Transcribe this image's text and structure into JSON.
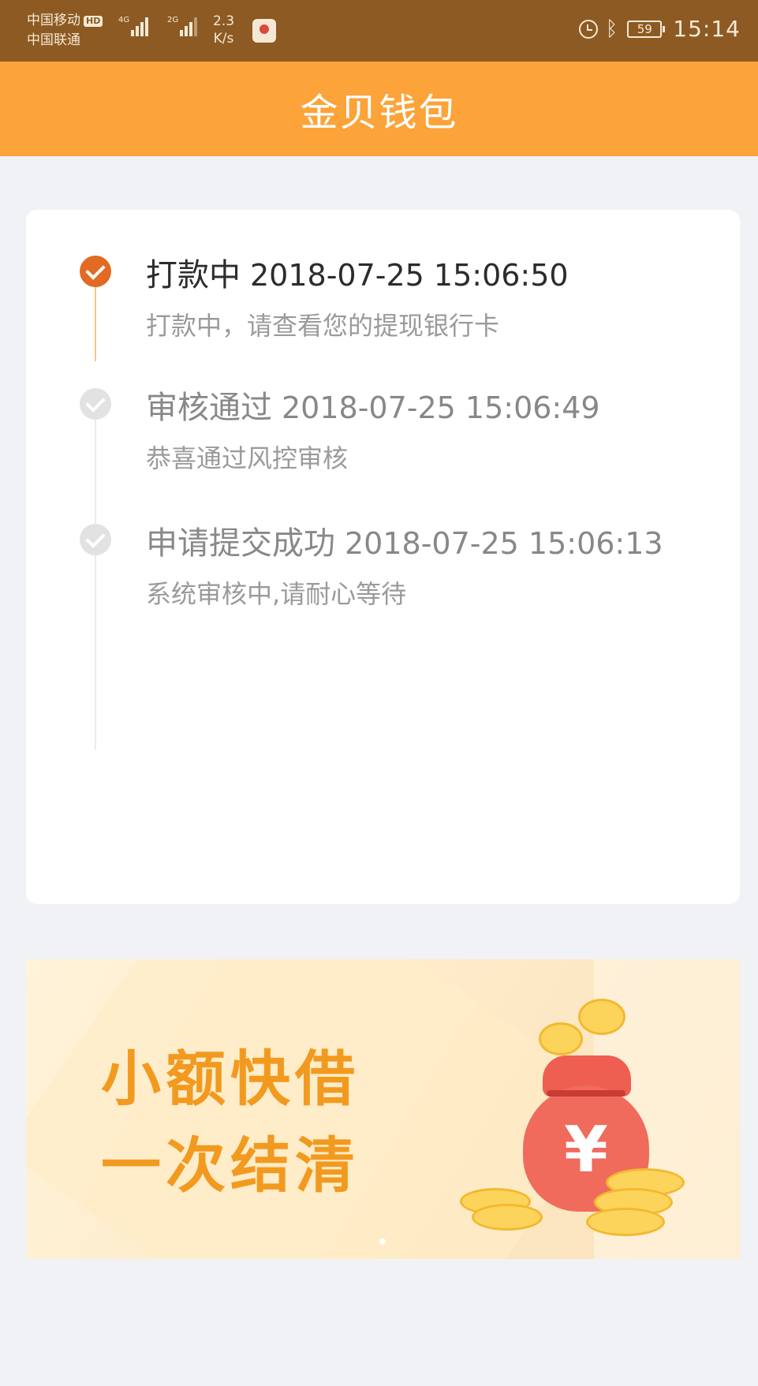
{
  "status_bar": {
    "carrier_1": "中国移动",
    "carrier_1_badge": "HD",
    "carrier_2": "中国联通",
    "signal_1_label": "4G",
    "signal_2_label": "2G",
    "net_speed_value": "2.3",
    "net_speed_unit": "K/s",
    "battery": "59",
    "time": "15:14",
    "icons": [
      "alarm-icon",
      "bluetooth-icon",
      "battery-icon"
    ]
  },
  "header": {
    "title": "金贝钱包"
  },
  "timeline": {
    "steps": [
      {
        "title": "打款中",
        "time": "2018-07-25 15:06:50",
        "desc": "打款中，请查看您的提现银行卡",
        "status": "active"
      },
      {
        "title": "审核通过",
        "time": "2018-07-25 15:06:49",
        "desc": "恭喜通过风控审核",
        "status": "done"
      },
      {
        "title": "申请提交成功",
        "time": "2018-07-25 15:06:13",
        "desc": "系统审核中,请耐心等待",
        "status": "done"
      }
    ]
  },
  "banner": {
    "line_1": "小额快借",
    "line_2": "一次结清",
    "symbol": "¥",
    "accent_color": "#f29a1f"
  },
  "colors": {
    "status_bar_bg": "#8c5a22",
    "header_bg": "#fca339",
    "active_step": "#e26a22",
    "inactive_step": "#e2e2e2",
    "page_bg": "#f0f2f6"
  }
}
